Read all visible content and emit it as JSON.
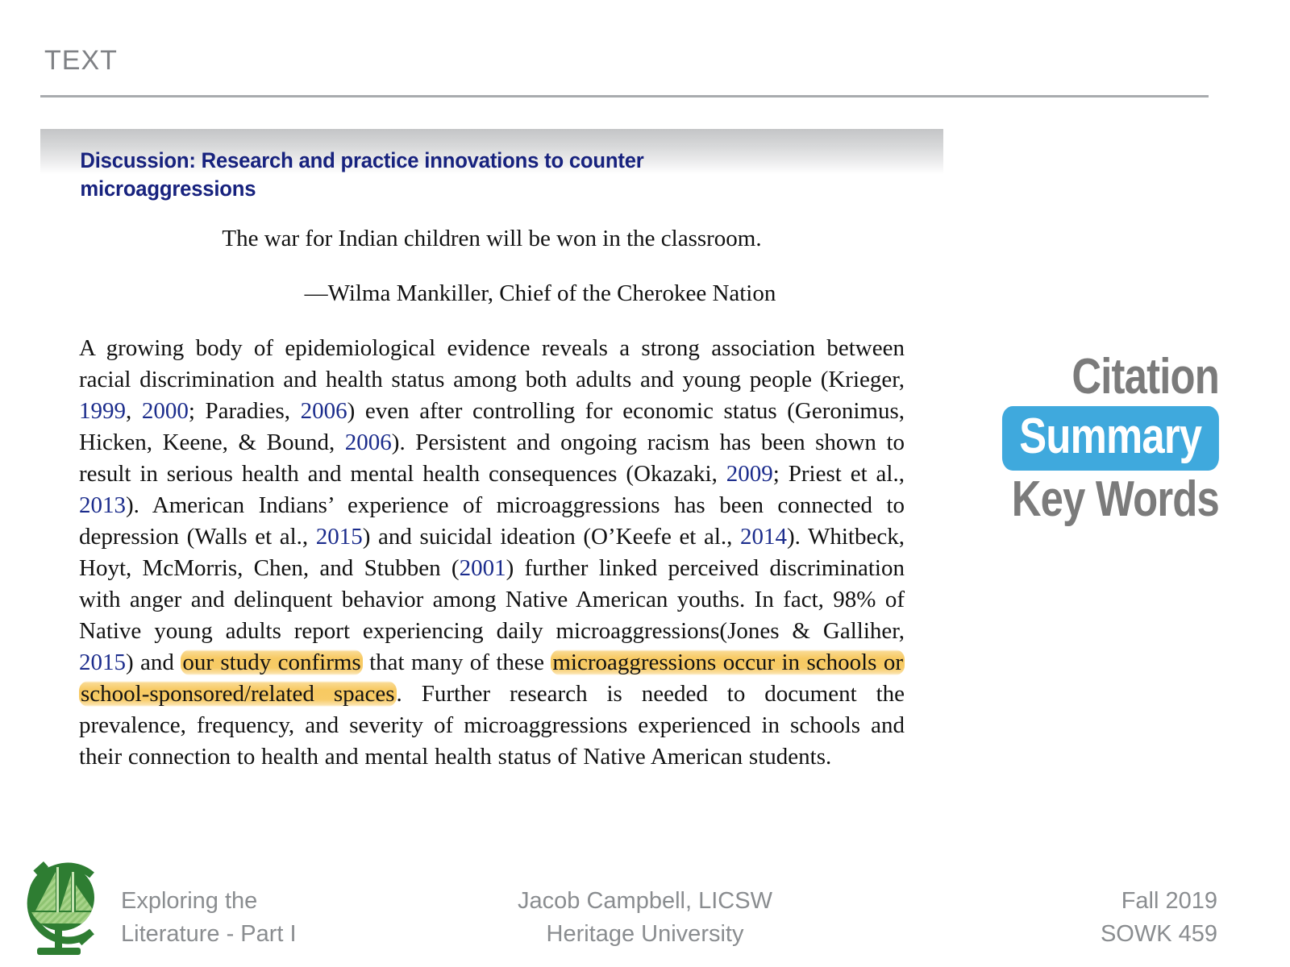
{
  "slide": {
    "title": "TEXT"
  },
  "article": {
    "heading": "Discussion: Research and practice innovations to counter microaggressions",
    "epigraph": "The war for Indian children will be won in the classroom.",
    "epigraph_attribution": "—Wilma Mankiller, Chief of the Cherokee Nation",
    "paragraph": {
      "p1": "A growing body of epidemiological evidence reveals a strong association between racial discrimination and health status among both adults and young people (Krieger, ",
      "y1999": "1999",
      "p2": ", ",
      "y2000": "2000",
      "p3": "; Paradies, ",
      "y2006a": "2006",
      "p4": ") even after controlling for economic status (Geronimus, Hicken, Keene, & Bound, ",
      "y2006b": "2006",
      "p5": "). Persistent and ongoing racism has been shown to result in serious health and mental health consequences (Okazaki, ",
      "y2009": "2009",
      "p6": "; Priest et al., ",
      "y2013": "2013",
      "p7": "). American Indians’ experience of microaggressions has been connected to depression (Walls et al., ",
      "y2015a": "2015",
      "p8": ") and suicidal ideation (O’Keefe et al., ",
      "y2014": "2014",
      "p9": "). Whitbeck, Hoyt, McMorris, Chen, and Stubben (",
      "y2001": "2001",
      "p10": ") further linked perceived discrimination with anger and delinquent behavior among Native American youths. In fact, 98% of Native young adults report experiencing daily microaggressions(Jones & Galliher, ",
      "y2015b": "2015",
      "p11": ") and ",
      "hl1": "our study confirms",
      "p12": " that many of these ",
      "hl2": "microaggressions occur in schools or school-sponsored/related spaces",
      "p13": ". Further research is needed to document the prevalence, frequency, and severity of microaggressions experienced in schools and their connection to health and mental health status of Native American students."
    }
  },
  "annotations": {
    "citation": "Citation",
    "summary": "Summary",
    "keywords": "Key Words",
    "highlight_color": "#3fa9dd",
    "muted_color": "#7b7b7b"
  },
  "footer": {
    "left_line1": "Exploring the",
    "left_line2": "Literature - Part I",
    "center_line1": "Jacob Campbell, LICSW",
    "center_line2": "Heritage University",
    "right_line1": "Fall 2019",
    "right_line2": "SOWK 459",
    "logo_name": "globe-sailboat-logo"
  },
  "colors": {
    "heading_navy": "#17227e",
    "citation_blue": "#1b2c8c",
    "highlight_amber": "#f6c24c",
    "logo_green_dark": "#2e7d32",
    "logo_green_light": "#a5d184"
  }
}
